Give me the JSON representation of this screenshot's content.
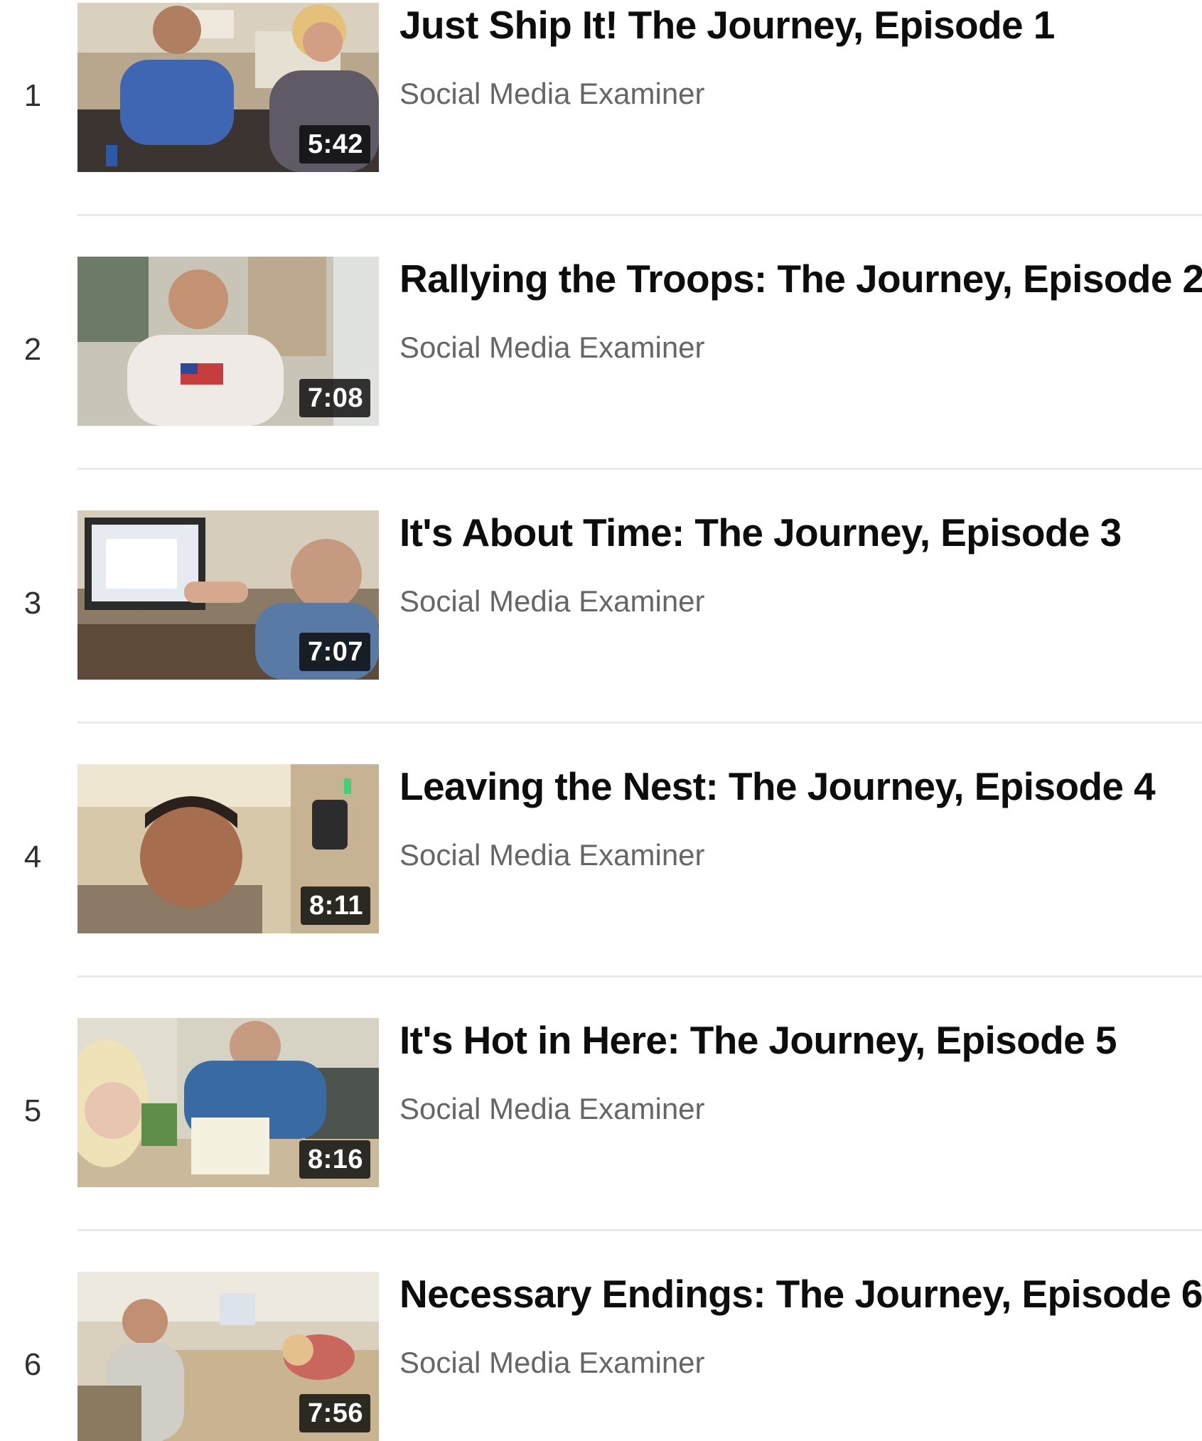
{
  "playlist": {
    "items": [
      {
        "index": "1",
        "title": "Just Ship It! The Journey, Episode 1",
        "channel": "Social Media Examiner",
        "duration": "5:42"
      },
      {
        "index": "2",
        "title": "Rallying the Troops: The Journey, Episode 2",
        "channel": "Social Media Examiner",
        "duration": "7:08"
      },
      {
        "index": "3",
        "title": "It's About Time: The Journey, Episode 3",
        "channel": "Social Media Examiner",
        "duration": "7:07"
      },
      {
        "index": "4",
        "title": "Leaving the Nest: The Journey, Episode 4",
        "channel": "Social Media Examiner",
        "duration": "8:11"
      },
      {
        "index": "5",
        "title": "It's Hot in Here: The Journey, Episode 5",
        "channel": "Social Media Examiner",
        "duration": "8:16"
      },
      {
        "index": "6",
        "title": "Necessary Endings: The Journey, Episode 6",
        "channel": "Social Media Examiner",
        "duration": "7:56"
      }
    ]
  }
}
